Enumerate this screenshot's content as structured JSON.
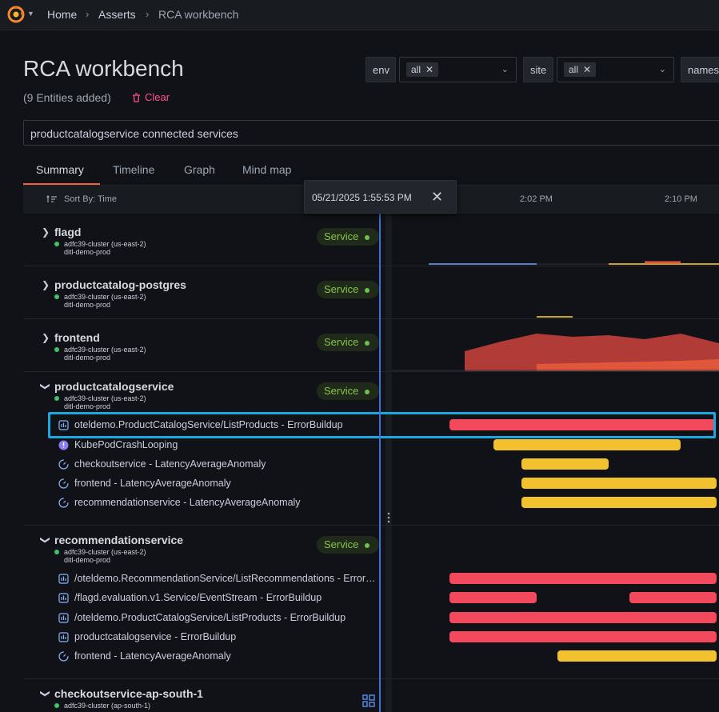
{
  "breadcrumb": {
    "home": "Home",
    "asserts": "Asserts",
    "current": "RCA workbench"
  },
  "page": {
    "title": "RCA workbench",
    "entities_added": "(9 Entities added)",
    "clear": "Clear"
  },
  "filters": [
    {
      "label": "env",
      "value": "all"
    },
    {
      "label": "site",
      "value": "all"
    },
    {
      "label": "names"
    }
  ],
  "search": {
    "value": "productcatalogservice connected services"
  },
  "tabs": [
    "Summary",
    "Timeline",
    "Graph",
    "Mind map"
  ],
  "list_header": {
    "sort_by": "Sort By: Time",
    "ticks": [
      "2:02 PM",
      "2:10 PM"
    ]
  },
  "tooltip": {
    "time": "05/21/2025 1:55:53 PM"
  },
  "badge_label": "Service",
  "entities": [
    {
      "name": "flagd",
      "cluster": "adfc39-cluster (us-east-2)",
      "env": "ditl-demo-prod"
    },
    {
      "name": "productcatalog-postgres",
      "cluster": "adfc39-cluster (us-east-2)",
      "env": "ditl-demo-prod"
    },
    {
      "name": "frontend",
      "cluster": "adfc39-cluster (us-east-2)",
      "env": "ditl-demo-prod"
    },
    {
      "name": "productcatalogservice",
      "cluster": "adfc39-cluster (us-east-2)",
      "env": "ditl-demo-prod",
      "assertions": [
        "oteldemo.ProductCatalogService/ListProducts - ErrorBuildup",
        "KubePodCrashLooping",
        "checkoutservice - LatencyAverageAnomaly",
        "frontend - LatencyAverageAnomaly",
        "recommendationservice - LatencyAverageAnomaly"
      ]
    },
    {
      "name": "recommendationservice",
      "cluster": "adfc39-cluster (us-east-2)",
      "env": "ditl-demo-prod",
      "assertions": [
        "/oteldemo.RecommendationService/ListRecommendations - ErrorBuildup",
        "/flagd.evaluation.v1.Service/EventStream - ErrorBuildup",
        "/oteldemo.ProductCatalogService/ListProducts - ErrorBuildup",
        "productcatalogservice - ErrorBuildup",
        "frontend - LatencyAverageAnomaly"
      ]
    },
    {
      "name": "checkoutservice-ap-south-1",
      "cluster": "adfc39-cluster (ap-south-1)"
    }
  ],
  "colors": {
    "error": "#f2495c",
    "warning": "#f2c12e",
    "now_line": "#3d71d9",
    "highlight": "#1ba7e0",
    "tab_accent": "#f55f3e"
  }
}
